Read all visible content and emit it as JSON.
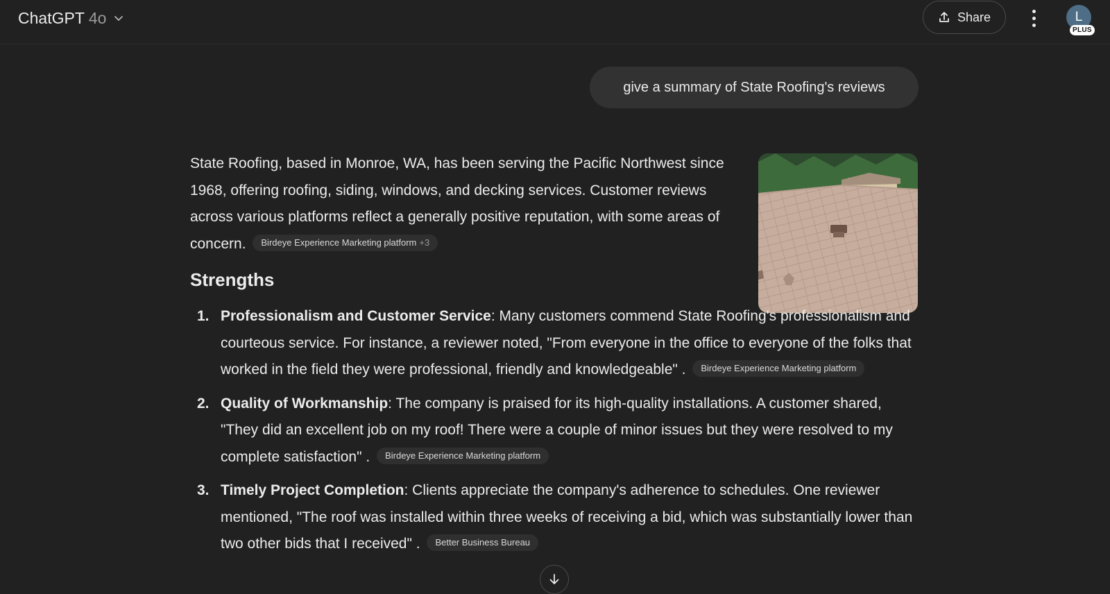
{
  "header": {
    "app_name": "ChatGPT",
    "model_version": "4o",
    "share_label": "Share",
    "avatar_initial": "L",
    "plan_badge": "PLUS"
  },
  "conversation": {
    "user_message": "give a summary of State Roofing's reviews",
    "intro_text": "State Roofing, based in Monroe, WA, has been serving the Pacific Northwest since 1968, offering roofing, siding, windows, and decking services. Customer reviews across various platforms reflect a generally positive reputation, with some areas of concern.",
    "intro_source": "Birdeye Experience Marketing platform",
    "intro_source_more": "+3",
    "heading": "Strengths",
    "items": [
      {
        "number": "1.",
        "title": "Professionalism and Customer Service",
        "text": ": Many customers commend State Roofing's professionalism and courteous service. For instance, a reviewer noted, \"From everyone in the office to everyone of the folks that worked in the field they were professional, friendly and knowledgeable\" .",
        "source": "Birdeye Experience Marketing platform"
      },
      {
        "number": "2.",
        "title": "Quality of Workmanship",
        "text": ": The company is praised for its high-quality installations. A customer shared, \"They did an excellent job on my roof! There were a couple of minor issues but they were resolved to my complete satisfaction\" .",
        "source": "Birdeye Experience Marketing platform"
      },
      {
        "number": "3.",
        "title": "Timely Project Completion",
        "text": ": Clients appreciate the company's adherence to schedules. One reviewer mentioned, \"The roof was installed within three weeks of receiving a bid, which was substantially lower than two other bids that I received\" .",
        "source": "Better Business Bureau"
      }
    ]
  },
  "icons": {
    "model_dropdown": "chevron-down-icon",
    "share": "upload-icon",
    "more": "more-vertical-icon",
    "scroll_down": "arrow-down-icon"
  },
  "colors": {
    "background": "#212121",
    "user_bubble": "#323232",
    "chip": "#2f2f2f",
    "text": "#ececec"
  }
}
